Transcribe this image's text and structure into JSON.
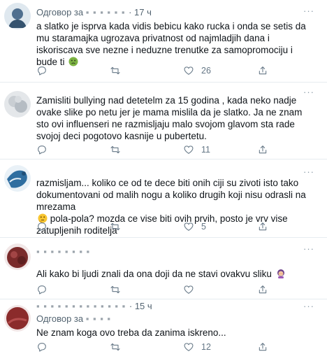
{
  "tweets": [
    {
      "name": "",
      "reply_label": "Одговор за",
      "time": "· 17 ч",
      "text": "a slatko je isprva kada vidis bebicu kako rucka i onda se setis da mu staramajka ugrozava privatnost od najmladjih dana i iskoriscava sve nezne i neduzne trenutke za samopromociju i bude ti",
      "emoji": "sick-face",
      "likes": "26",
      "avatar": "blue-silhouette"
    },
    {
      "name": "",
      "reply_label": "",
      "time": "",
      "text": "Zamisliti bullying nad detetelm za 15 godina , kada neko nadje ovake slike po netu jer je mama mislila da je slatko.  Ja ne znam sto ovi influenseri ne razmisljaju malo svojom glavom sta rade svojoj deci pogotovo kasnije u pubertetu.",
      "likes": "11",
      "avatar": "gray-blur"
    },
    {
      "name": "",
      "reply_label": "",
      "time": "",
      "text": "razmisljam... koliko ce od te dece biti onih ciji su zivoti isto tako dokumentovani od malih nogu a koliko drugih koji nisu odrasli na mrezama",
      "text2": "pola-pola? mozda ce vise biti ovih prvih, posto je vrv vise zatupljenih roditelja",
      "emoji": "thinking-face",
      "likes": "5",
      "avatar": "blue-splash"
    },
    {
      "name": "",
      "reply_label": "",
      "time": "",
      "text": "Ali kako bi ljudi znali da ona doji da ne stavi ovakvu sliku",
      "emoji": "woman-facepalming",
      "likes": "",
      "avatar": "dark-red"
    },
    {
      "name": "",
      "reply_label": "Одговор за",
      "time": "· 15 ч",
      "text": "Ne znam koga ovo treba da zanima iskreno...",
      "likes": "12",
      "avatar": "dark-red-2"
    }
  ],
  "more_label": "···"
}
